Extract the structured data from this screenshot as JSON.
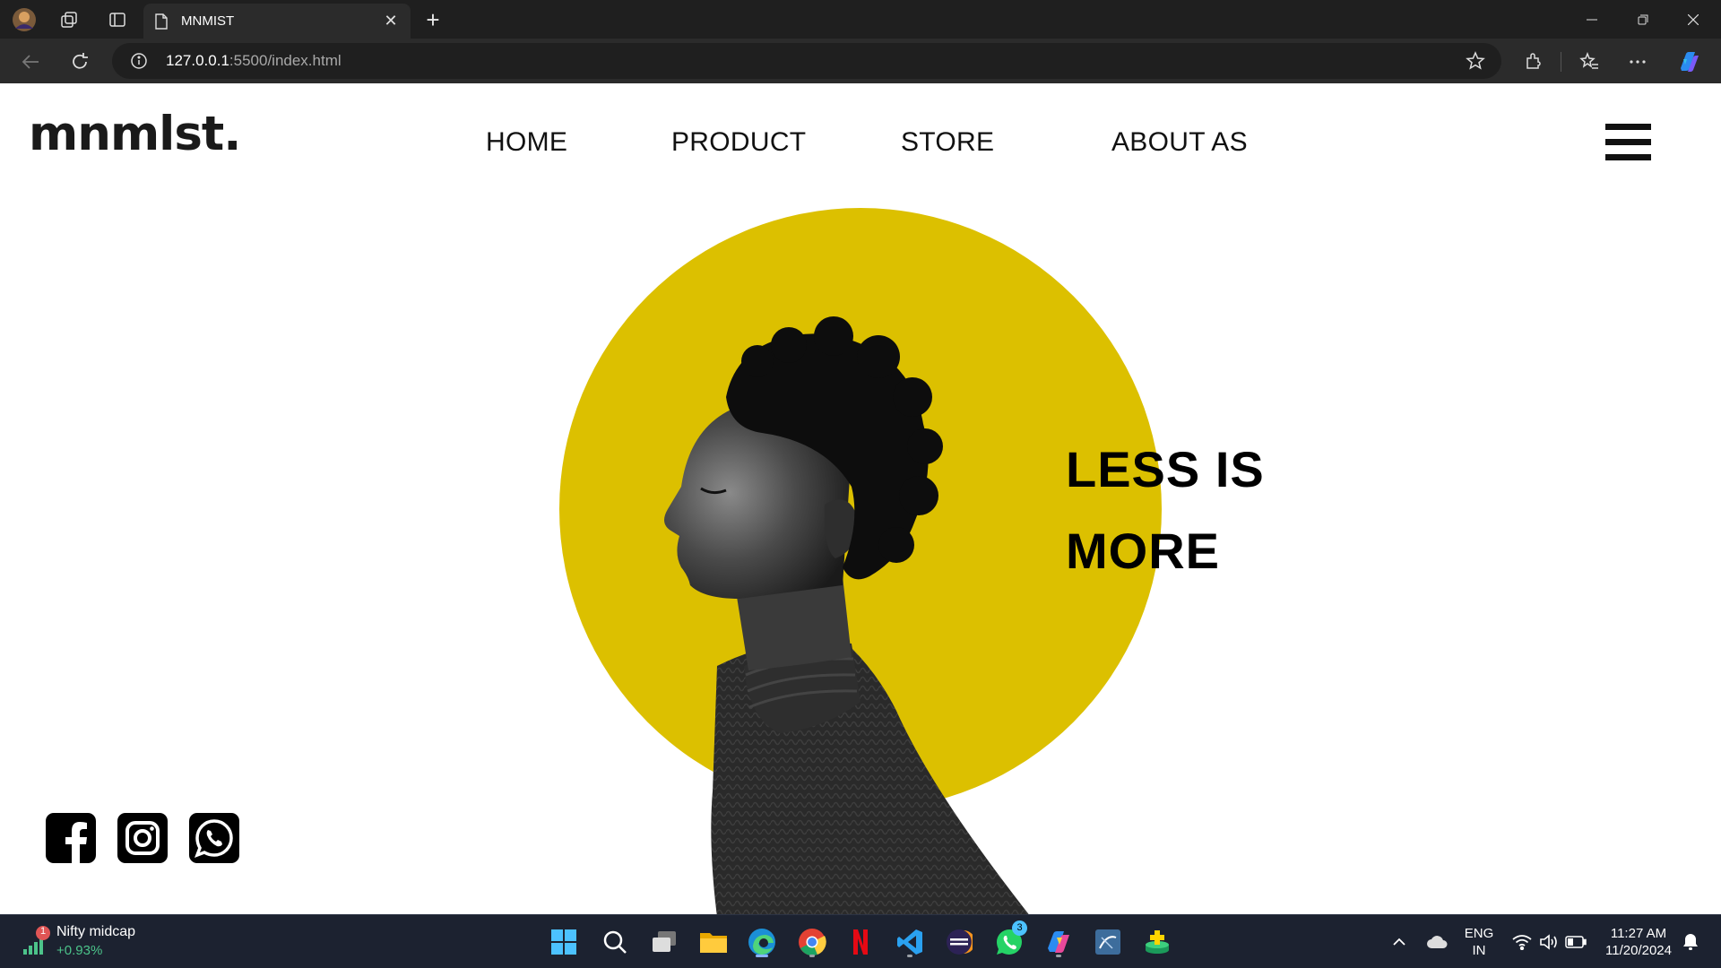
{
  "browser": {
    "tab_title": "MNMIST",
    "url_host": "127.0.0.1",
    "url_rest": ":5500/index.html"
  },
  "site": {
    "logo": "mnmlst.",
    "nav": [
      "HOME",
      "PRODUCT",
      "STORE",
      "ABOUT AS"
    ],
    "headline_line1": "LESS IS",
    "headline_line2": "MORE"
  },
  "social_icons": [
    "facebook-icon",
    "instagram-icon",
    "whatsapp-icon"
  ],
  "taskbar": {
    "widget_title": "Nifty midcap",
    "widget_change": "+0.93%",
    "widget_badge": "1",
    "whatsapp_badge": "3",
    "lang_line1": "ENG",
    "lang_line2": "IN",
    "time": "11:27 AM",
    "date": "11/20/2024"
  },
  "colors": {
    "accent_yellow": "#dcc000",
    "taskbar_bg": "#1c2230",
    "positive_green": "#4cc38a"
  }
}
